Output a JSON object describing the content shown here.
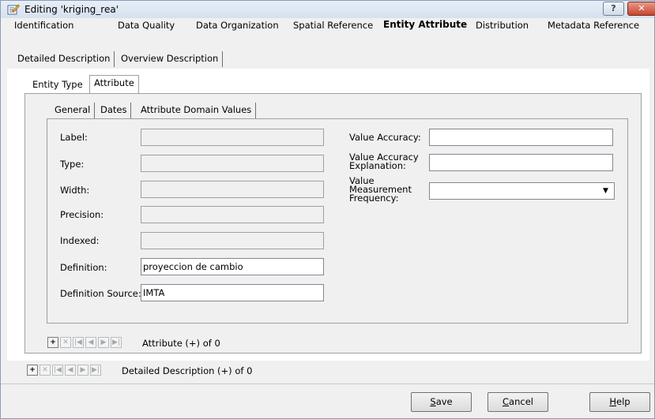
{
  "window": {
    "title": "Editing 'kriging_rea'",
    "help_label": "?",
    "close_label": "✕"
  },
  "main_tabs": [
    {
      "label": "Identification"
    },
    {
      "label": "Data Quality"
    },
    {
      "label": "Data Organization"
    },
    {
      "label": "Spatial Reference"
    },
    {
      "label": "Entity Attribute"
    },
    {
      "label": "Distribution"
    },
    {
      "label": "Metadata Reference"
    }
  ],
  "sub_tabs": [
    {
      "label": "Detailed Description"
    },
    {
      "label": "Overview Description"
    }
  ],
  "entity_tabs": [
    {
      "label": "Entity Type"
    },
    {
      "label": "Attribute"
    }
  ],
  "attr_tabs": [
    {
      "label": "General"
    },
    {
      "label": "Dates"
    },
    {
      "label": "Attribute Domain Values"
    }
  ],
  "left_fields": {
    "label": {
      "label": "Label:",
      "value": ""
    },
    "type": {
      "label": "Type:",
      "value": ""
    },
    "width": {
      "label": "Width:",
      "value": ""
    },
    "precision": {
      "label": "Precision:",
      "value": ""
    },
    "indexed": {
      "label": "Indexed:",
      "value": ""
    },
    "definition": {
      "label": "Definition:",
      "value": "proyeccion de cambio"
    },
    "definition_source": {
      "label": "Definition Source:",
      "value": "IMTA"
    }
  },
  "right_fields": {
    "value_accuracy": {
      "label": "Value Accuracy:",
      "value": ""
    },
    "value_accuracy_explanation": {
      "label": "Value Accuracy Explanation:",
      "value": ""
    },
    "value_measurement_frequency": {
      "label": "Value Measurement Frequency:",
      "value": ""
    }
  },
  "attribute_nav": {
    "text": "Attribute (+) of 0"
  },
  "detailed_nav": {
    "text": "Detailed Description (+) of 0"
  },
  "nav_glyphs": {
    "add": "+",
    "delete": "✕",
    "first": "|◀",
    "prev": "◀",
    "next": "▶",
    "last": "▶|"
  },
  "buttons": {
    "save_u": "S",
    "save_rest": "ave",
    "cancel_u": "C",
    "cancel_rest": "ancel",
    "help_u": "H",
    "help_rest": "elp"
  },
  "colors": {
    "accent": "#d6e1ee",
    "close": "#c6452b"
  }
}
